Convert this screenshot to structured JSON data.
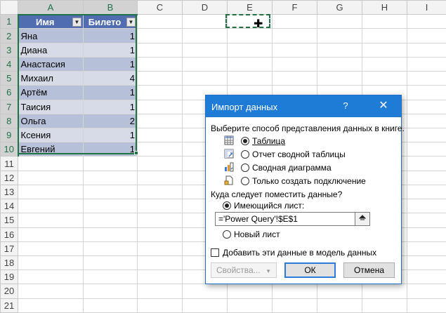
{
  "columns": [
    "A",
    "B",
    "C",
    "D",
    "E",
    "F",
    "G",
    "H",
    "I"
  ],
  "rows": [
    "1",
    "2",
    "3",
    "4",
    "5",
    "6",
    "7",
    "8",
    "9",
    "10",
    "11",
    "12",
    "13",
    "14",
    "15",
    "16",
    "17",
    "18",
    "19",
    "20",
    "21"
  ],
  "table": {
    "headers": [
      "Имя",
      "Билето"
    ],
    "data": [
      [
        "Яна",
        "1"
      ],
      [
        "Диана",
        "1"
      ],
      [
        "Анастасия",
        "1"
      ],
      [
        "Михаил",
        "4"
      ],
      [
        "Артём",
        "1"
      ],
      [
        "Таисия",
        "1"
      ],
      [
        "Ольга",
        "2"
      ],
      [
        "Ксения",
        "1"
      ],
      [
        "Евгений",
        "1"
      ]
    ]
  },
  "dialog": {
    "title": "Импорт данных",
    "help": "?",
    "close": "✕",
    "view_prompt": "Выберите способ представления данных в книге.",
    "view_options": [
      {
        "label": "Таблица",
        "selected": true
      },
      {
        "label": "Отчет сводной таблицы",
        "selected": false
      },
      {
        "label": "Сводная диаграмма",
        "selected": false
      },
      {
        "label": "Только создать подключение",
        "selected": false
      }
    ],
    "dest_prompt": "Куда следует поместить данные?",
    "dest_existing": "Имеющийся лист:",
    "dest_reference": "='Power Query'!$E$1",
    "dest_new": "Новый лист",
    "add_to_model": "Добавить эти данные в модель данных",
    "properties_button": "Свойства...",
    "ok_button": "ОК",
    "cancel_button": "Отмена"
  },
  "colors": {
    "accent": "#217346",
    "dialog_title": "#1e7bd6",
    "table_header": "#4f6db0",
    "band_dark": "#b6c1d9",
    "band_light": "#d6dbe7"
  }
}
